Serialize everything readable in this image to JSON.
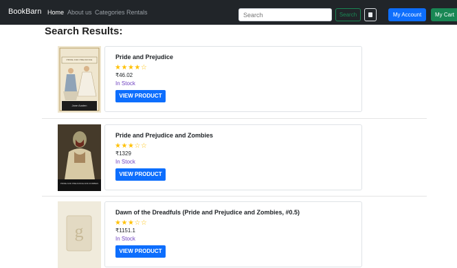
{
  "nav": {
    "brand": "BookBarn",
    "links": [
      "Home",
      "About us",
      "Categories",
      "Rentals"
    ],
    "search_placeholder": "Search",
    "search_button": "Search",
    "account_button": "My Account",
    "cart_button": "My Cart"
  },
  "page": {
    "title": "Search Results:"
  },
  "results": [
    {
      "title": "Pride and Prejudice",
      "rating": 4,
      "max_rating": 5,
      "price": "₹46.02",
      "stock": "In Stock",
      "button": "VIEW PRODUCT",
      "cover_caption": "Jane Austen",
      "cover_top_text": "PRIDE AND PREJUDICE"
    },
    {
      "title": "Pride and Prejudice and Zombies",
      "rating": 3,
      "max_rating": 5,
      "price": "₹1329",
      "stock": "In Stock",
      "button": "VIEW PRODUCT",
      "cover_caption": "PRIDE AND PREJUDICE AND ZOMBIES"
    },
    {
      "title": "Dawn of the Dreadfuls (Pride and Prejudice and Zombies, #0.5)",
      "rating": 3,
      "max_rating": 5,
      "price": "₹1151.1",
      "stock": "In Stock",
      "button": "VIEW PRODUCT",
      "cover_placeholder_letter": "g"
    }
  ],
  "colors": {
    "navbar": "#212529",
    "primary": "#0d6efd",
    "success": "#198754",
    "star": "#ffc107",
    "stock": "#6f42c1"
  }
}
